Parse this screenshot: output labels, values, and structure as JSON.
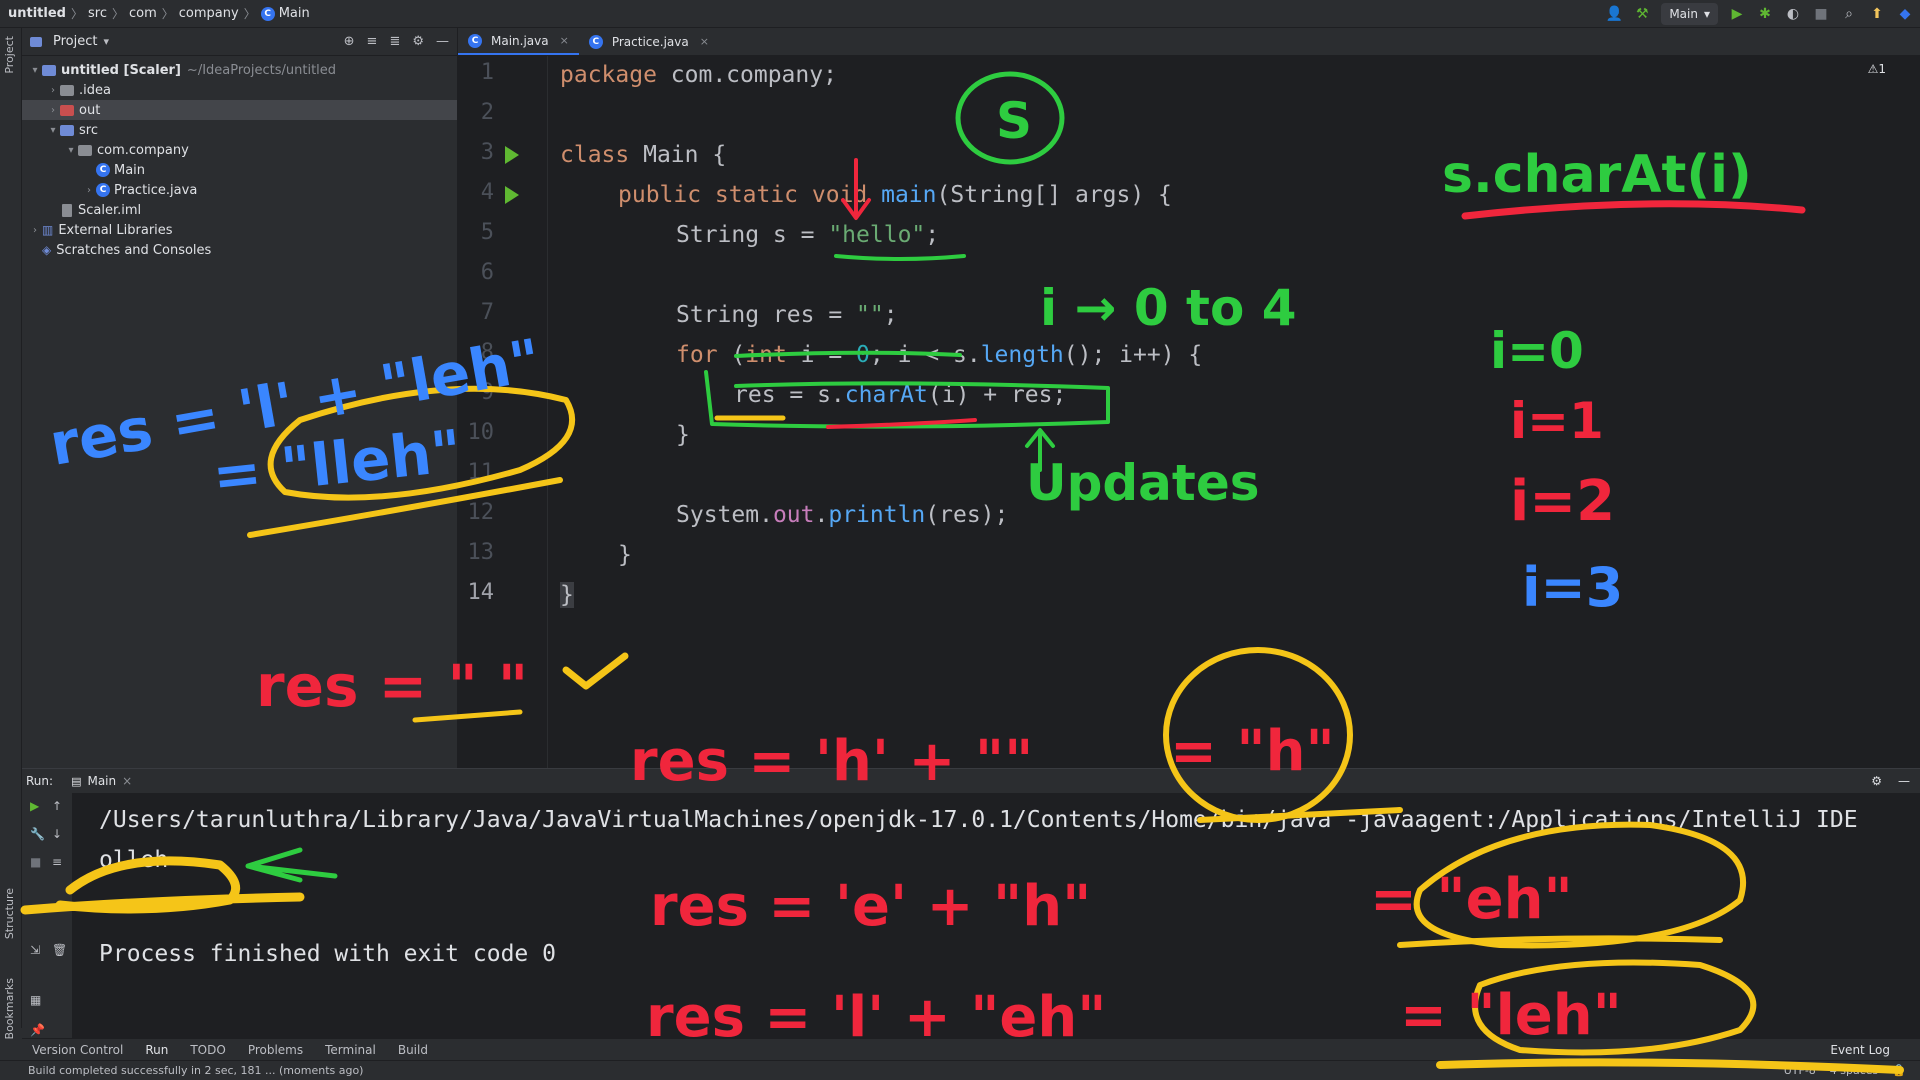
{
  "breadcrumb": [
    "untitled",
    "src",
    "com",
    "company",
    "Main"
  ],
  "run_config": "Main",
  "project": {
    "title": "Project",
    "tree": [
      {
        "label": "untitled [Scaler]",
        "extra": "~/IdeaProjects/untitled"
      },
      {
        "label": ".idea"
      },
      {
        "label": "out"
      },
      {
        "label": "src"
      },
      {
        "label": "com.company"
      },
      {
        "label": "Main"
      },
      {
        "label": "Practice.java"
      },
      {
        "label": "Scaler.iml"
      },
      {
        "label": "External Libraries"
      },
      {
        "label": "Scratches and Consoles"
      }
    ]
  },
  "tabs": [
    {
      "label": "Main.java"
    },
    {
      "label": "Practice.java"
    }
  ],
  "editor": {
    "warnings": "⚠1",
    "line_numbers": [
      "1",
      "2",
      "3",
      "4",
      "5",
      "6",
      "7",
      "8",
      "9",
      "10",
      "11",
      "12",
      "13",
      "14"
    ],
    "code": {
      "l1_kw": "package",
      "l1_rest": " com.company;",
      "l3_kw": "class",
      "l3_rest": " Main {",
      "l4_kw": "public static void",
      "l4_fn": "main",
      "l4_rest": "(String[] args) {",
      "l5_a": "String s = ",
      "l5_str": "\"hello\"",
      "l5_b": ";",
      "l7_a": "String res = ",
      "l7_str": "\"\"",
      "l7_b": ";",
      "l8_kw": "for",
      "l8_a": " (",
      "l8_kw2": "int",
      "l8_b": " i = ",
      "l8_num": "0",
      "l8_c": "; i < s.",
      "l8_fn": "length",
      "l8_d": "(); i++) {",
      "l9_a": "res = s.",
      "l9_fn": "charAt",
      "l9_b": "(i) + res;",
      "l10": "}",
      "l12_a": "System.",
      "l12_fld": "out",
      "l12_b": ".",
      "l12_fn": "println",
      "l12_c": "(res);",
      "l13": "}",
      "l14": "}"
    }
  },
  "run": {
    "label": "Run:",
    "tab": "Main",
    "lines": [
      "/Users/tarunluthra/Library/Java/JavaVirtualMachines/openjdk-17.0.1/Contents/Home/bin/java -javaagent:/Applications/IntelliJ IDE",
      "olleh",
      "Process finished with exit code 0"
    ]
  },
  "bottom_tabs": [
    "Version Control",
    "Run",
    "TODO",
    "Problems",
    "Terminal",
    "Build"
  ],
  "event_log": "Event Log",
  "status": {
    "message": "Build completed successfully in 2 sec, 181 ... (moments ago)",
    "encoding": "UTF-8",
    "indent": "4 spaces"
  },
  "left_strip": {
    "project": "Project",
    "structure": "Structure",
    "bookmarks": "Bookmarks"
  },
  "annotations": {
    "s_circle": "S",
    "charAt": "s.charAt(i)",
    "range": "i → 0 to 4",
    "i0": "i=0",
    "i1": "i=1",
    "i2": "i=2",
    "i3": "i=3",
    "updates": "Updates",
    "res_l_leh": "res = 'l' + \"leh\"",
    "lleh": "= \"lleh\"",
    "res_empty": "res = \" \"",
    "res_h": "res = 'h' + \"\"",
    "h": "= \"h\"",
    "res_e": "res = 'e' + \"h\"",
    "eh": "= \"eh\"",
    "res_l_eh": "res = 'l' + \"eh\"",
    "leh": "= \"leh\""
  }
}
